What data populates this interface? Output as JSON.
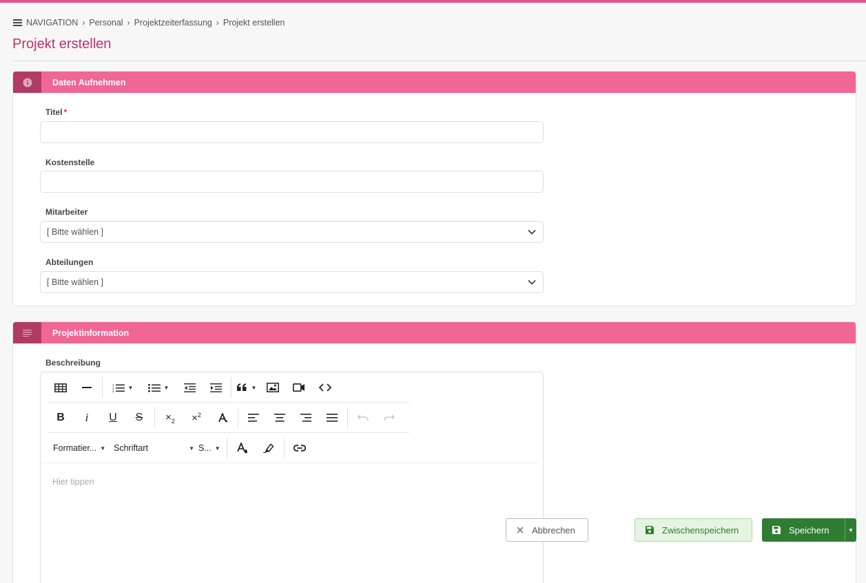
{
  "breadcrumb": {
    "nav_label": "NAVIGATION",
    "items": [
      "Personal",
      "Projektzeiterfassung",
      "Projekt erstellen"
    ]
  },
  "page": {
    "title": "Projekt erstellen"
  },
  "panel_data": {
    "title": "Daten Aufnehmen",
    "icon": "info-icon",
    "fields": {
      "title": {
        "label": "Titel",
        "required_mark": "*",
        "value": ""
      },
      "cost_center": {
        "label": "Kostenstelle",
        "value": ""
      },
      "employee": {
        "label": "Mitarbeiter",
        "selected": "[ Bitte wählen ]"
      },
      "departments": {
        "label": "Abteilungen",
        "selected": "[ Bitte wählen ]"
      }
    }
  },
  "panel_info": {
    "title": "Projektinformation",
    "icon": "text-lines-icon",
    "description": {
      "label": "Beschreibung",
      "placeholder": "Hier tippen",
      "format_dropdown": "Formatier...",
      "font_dropdown": "Schriftart",
      "size_dropdown": "S..."
    }
  },
  "actions": {
    "cancel": "Abbrechen",
    "draft": "Zwischenspeichern",
    "save": "Speichern"
  },
  "colors": {
    "accent": "#e8508a",
    "panel_header": "#f06694",
    "panel_icon_bg": "#b13b64",
    "title": "#c2306a",
    "save": "#2e7d32",
    "draft_bg": "#e5f5e2"
  }
}
